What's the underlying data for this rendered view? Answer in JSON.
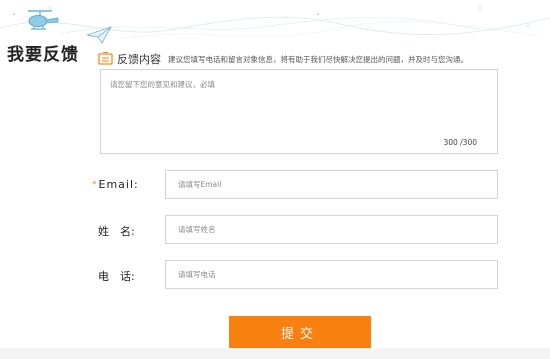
{
  "page_title": "我要反馈",
  "section": {
    "title": "反馈内容",
    "description": "建议您填写电话和留言对象信息，将有助于我们尽快解决您提出的问题，并及时与您沟通。"
  },
  "feedback": {
    "placeholder": "请您留下您的意见和建议，必填",
    "char_count": "300 /300"
  },
  "fields": {
    "email": {
      "label": "Email:",
      "required_mark": "*",
      "placeholder": "请填写Email"
    },
    "name": {
      "label": "姓　名:",
      "placeholder": "请填写姓名"
    },
    "phone": {
      "label": "电　话:",
      "placeholder": "请填写电话"
    }
  },
  "submit_label": "提交",
  "colors": {
    "accent": "#f97f0e",
    "border": "#d4d4d4",
    "deco_line": "#c9dde4"
  },
  "icons": [
    "helicopter-icon",
    "paper-plane-icon",
    "feedback-section-icon"
  ]
}
